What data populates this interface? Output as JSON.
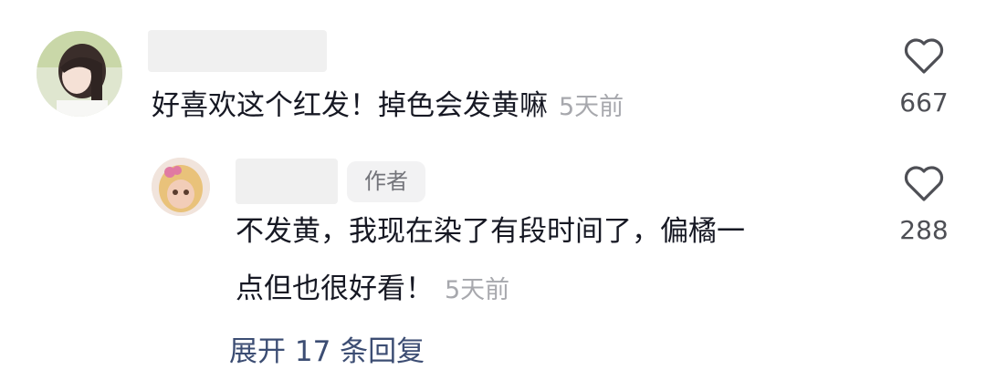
{
  "comment": {
    "text": "好喜欢这个红发！掉色会发黄嘛",
    "time": "5天前",
    "likes": "667",
    "like_icon": "heart-outline-icon"
  },
  "reply": {
    "badge": "作者",
    "text_line1": "不发黄，我现在染了有段时间了，偏橘一",
    "text_line2": "点但也很好看！",
    "time": "5天前",
    "likes": "288",
    "like_icon": "heart-outline-icon"
  },
  "expand_replies": "展开 17 条回复"
}
